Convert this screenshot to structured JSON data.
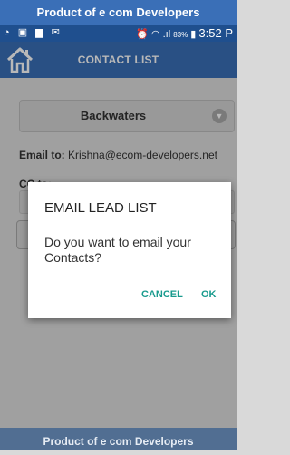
{
  "top_banner": {
    "text": "Product of e com Developers"
  },
  "status_bar": {
    "left_icons": "◔ ▣ ▆ ✉",
    "right_icons": "⏰ ◠ .ıl",
    "battery_pct": "83%",
    "battery_glyph": "▮",
    "time": "3:52 P"
  },
  "app_bar": {
    "title": "CONTACT LIST",
    "home_icon": "home-icon"
  },
  "form": {
    "selected_group": "Backwaters",
    "email_label": "Email to:",
    "email_value": "Krishna@ecom-developers.net",
    "cc_label": "CC to:"
  },
  "dialog": {
    "title": "EMAIL LEAD LIST",
    "message": "Do you want to email your Contacts?",
    "cancel_label": "CANCEL",
    "ok_label": "OK"
  },
  "bottom_banner": {
    "text": "Product of e com Developers"
  },
  "colors": {
    "header_blue": "#3a6fb7",
    "status_blue": "#1f4f8e",
    "button_teal": "#1a9b8e",
    "bottom_banner": "#516e92"
  }
}
